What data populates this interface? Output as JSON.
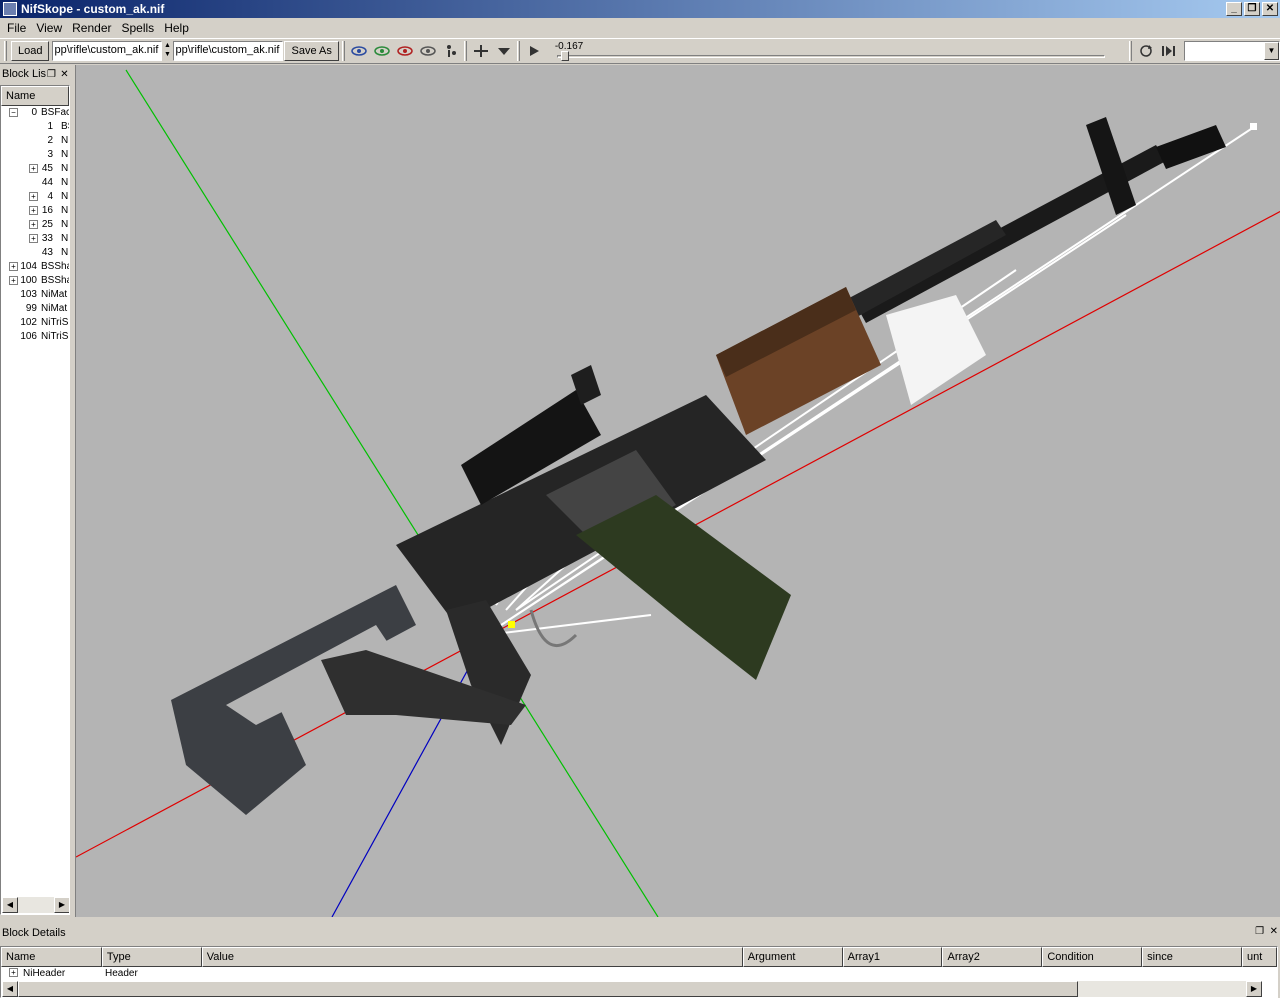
{
  "window": {
    "title": "NifSkope - custom_ak.nif",
    "minimize": "_",
    "restore": "❐",
    "close": "✕"
  },
  "menu": [
    "File",
    "View",
    "Render",
    "Spells",
    "Help"
  ],
  "toolbar": {
    "load_label": "Load",
    "path1": "pp\\rifle\\custom_ak.nif",
    "path2": "pp\\rifle\\custom_ak.nif",
    "save_as_label": "Save As",
    "time_value": "-0.167",
    "anim_combo_value": ""
  },
  "block_list": {
    "title": "Block Lis",
    "column": "Name",
    "rows": [
      {
        "num": "0",
        "name": "BSFac",
        "expander": "−",
        "level": 0
      },
      {
        "num": "1",
        "name": "BS",
        "expander": "",
        "level": 1
      },
      {
        "num": "2",
        "name": "N",
        "expander": "",
        "level": 1
      },
      {
        "num": "3",
        "name": "N",
        "expander": "",
        "level": 1
      },
      {
        "num": "45",
        "name": "N",
        "expander": "+",
        "level": 1
      },
      {
        "num": "44",
        "name": "N",
        "expander": "",
        "level": 1
      },
      {
        "num": "4",
        "name": "N",
        "expander": "+",
        "level": 1
      },
      {
        "num": "16",
        "name": "N",
        "expander": "+",
        "level": 1
      },
      {
        "num": "25",
        "name": "N",
        "expander": "+",
        "level": 1
      },
      {
        "num": "33",
        "name": "N",
        "expander": "+",
        "level": 1
      },
      {
        "num": "43",
        "name": "N",
        "expander": "",
        "level": 1
      },
      {
        "num": "104",
        "name": "BSSha",
        "expander": "+",
        "level": 2
      },
      {
        "num": "100",
        "name": "BSSha",
        "expander": "+",
        "level": 2
      },
      {
        "num": "103",
        "name": "NiMat",
        "expander": "",
        "level": 2
      },
      {
        "num": "99",
        "name": "NiMat",
        "expander": "",
        "level": 2
      },
      {
        "num": "102",
        "name": "NiTriSl",
        "expander": "",
        "level": 2
      },
      {
        "num": "106",
        "name": "NiTriSl",
        "expander": "",
        "level": 2
      }
    ]
  },
  "block_details": {
    "title": "Block Details",
    "columns": [
      "Name",
      "Type",
      "Value",
      "Argument",
      "Array1",
      "Array2",
      "Condition",
      "since",
      "unt"
    ],
    "row": {
      "name": "NiHeader",
      "type": "Header"
    }
  },
  "colors": {
    "viewport_bg": "#b4b4b4",
    "axis_x": "#e00000",
    "axis_y": "#00c000",
    "axis_z": "#0000c0"
  }
}
